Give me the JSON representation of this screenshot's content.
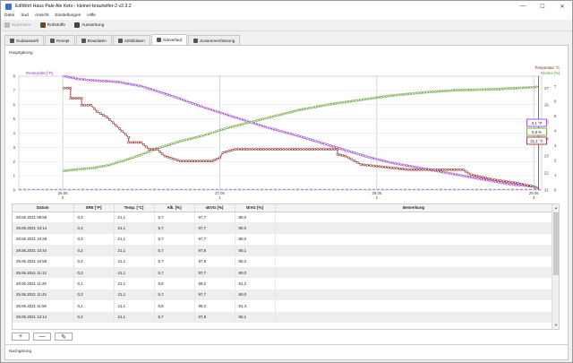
{
  "window": {
    "title": "EdiWort Haus Pale Ale Keto - kleiner-brauhelfer-2 v2.3.2",
    "minimize": "—",
    "maximize": "☐",
    "close": "✕"
  },
  "menu": [
    "Datei",
    "Sud",
    "Ansicht",
    "Einstellungen",
    "Hilfe"
  ],
  "toolbar": {
    "save": "Speichern",
    "ingredients": "Rohstoffe",
    "evaluation": "Auswertung"
  },
  "tabs": [
    "Sudauswahl",
    "Rezept",
    "Braudaten",
    "Abfülldaten",
    "Gärverlauf",
    "Zusammenfassung"
  ],
  "active_tab": "Gärverlauf",
  "groups": {
    "main": "Hauptgärung",
    "post": "Nachgärung"
  },
  "chart_data": {
    "type": "line",
    "left_axis": {
      "label": "Restextrakt [°P]",
      "ticks": [
        "0",
        "1",
        "2",
        "3",
        "4",
        "5",
        "6",
        "7",
        "8"
      ],
      "range": [
        0,
        8
      ]
    },
    "right_axis_1": {
      "label": "Temperatur °C",
      "ticks": [
        "21",
        "22",
        "23",
        "24",
        "25",
        "26",
        "27"
      ],
      "range": [
        21,
        27.7
      ]
    },
    "right_axis_2": {
      "label": "Alkohol [%]",
      "ticks": [
        "0",
        "1",
        "2",
        "3",
        "4",
        "5",
        "6",
        "7"
      ],
      "range": [
        0,
        7.7
      ]
    },
    "x_ticks": [
      {
        "date": "26.06",
        "day": "0"
      },
      {
        "date": "27.06",
        "day": "1"
      },
      {
        "date": "28.06",
        "day": "2"
      },
      {
        "date": "29.06",
        "day": "3"
      }
    ],
    "x_range_days": [
      -0.28,
      3.05
    ],
    "marker_x": 3.03,
    "marker_labels": {
      "extract": "0,1 °P",
      "alcohol": "5,8 %",
      "temperature": "21,1 °C"
    },
    "colors": {
      "extract": "#9b30d0",
      "alcohol": "#5a9a2a",
      "temperature": "#8b1a1a",
      "marker": "#cc2222"
    },
    "series": [
      {
        "key": "extract",
        "points": [
          [
            0.01,
            8.0
          ],
          [
            0.1,
            7.8
          ],
          [
            0.2,
            7.7
          ],
          [
            0.35,
            7.6
          ],
          [
            0.5,
            7.3
          ],
          [
            0.7,
            6.6
          ],
          [
            0.9,
            5.8
          ],
          [
            1.1,
            5.1
          ],
          [
            1.3,
            4.4
          ],
          [
            1.5,
            3.8
          ],
          [
            1.65,
            3.3
          ],
          [
            1.8,
            2.8
          ],
          [
            1.95,
            2.3
          ],
          [
            2.1,
            1.9
          ],
          [
            2.3,
            1.5
          ],
          [
            2.5,
            1.1
          ],
          [
            2.7,
            0.7
          ],
          [
            2.85,
            0.4
          ],
          [
            3.0,
            0.25
          ],
          [
            3.03,
            0.1
          ]
        ]
      },
      {
        "key": "alcohol",
        "points": [
          [
            0.01,
            1.3
          ],
          [
            0.1,
            1.4
          ],
          [
            0.2,
            1.5
          ],
          [
            0.3,
            1.7
          ],
          [
            0.45,
            2.2
          ],
          [
            0.6,
            2.8
          ],
          [
            0.75,
            3.3
          ],
          [
            0.9,
            3.7
          ],
          [
            1.05,
            4.2
          ],
          [
            1.2,
            4.6
          ],
          [
            1.35,
            5.0
          ],
          [
            1.5,
            5.4
          ],
          [
            1.7,
            5.8
          ],
          [
            1.9,
            6.1
          ],
          [
            2.1,
            6.4
          ],
          [
            2.3,
            6.6
          ],
          [
            2.5,
            6.75
          ],
          [
            2.7,
            6.8
          ],
          [
            2.9,
            6.9
          ],
          [
            3.0,
            6.95
          ],
          [
            3.03,
            7.0
          ]
        ]
      },
      {
        "key": "temperature",
        "points": [
          [
            0.01,
            27.0
          ],
          [
            0.05,
            27.0
          ],
          [
            0.05,
            26.4
          ],
          [
            0.12,
            26.4
          ],
          [
            0.12,
            26.0
          ],
          [
            0.18,
            26.0
          ],
          [
            0.22,
            25.6
          ],
          [
            0.28,
            25.3
          ],
          [
            0.34,
            24.8
          ],
          [
            0.42,
            24.1
          ],
          [
            0.42,
            23.8
          ],
          [
            0.5,
            23.8
          ],
          [
            0.55,
            23.4
          ],
          [
            0.6,
            23.4
          ],
          [
            0.65,
            23.0
          ],
          [
            0.75,
            22.7
          ],
          [
            0.95,
            22.7
          ],
          [
            1.0,
            22.9
          ],
          [
            1.02,
            23.2
          ],
          [
            1.1,
            23.4
          ],
          [
            1.75,
            23.4
          ],
          [
            1.75,
            23.1
          ],
          [
            1.8,
            23.0
          ],
          [
            1.9,
            22.5
          ],
          [
            2.0,
            22.4
          ],
          [
            2.2,
            22.2
          ],
          [
            2.55,
            22.2
          ],
          [
            2.6,
            21.9
          ],
          [
            2.75,
            21.6
          ],
          [
            2.9,
            21.4
          ],
          [
            3.0,
            21.2
          ],
          [
            3.03,
            21.1
          ]
        ]
      }
    ]
  },
  "table": {
    "headers": [
      "Datum",
      "SRE [°P]",
      "Temp. [°C]",
      "Alk. [%]",
      "sEVG [%]",
      "tEVG [%]",
      "Bemerkung"
    ],
    "rows": [
      [
        "29.06.2021 09:59",
        "0,3",
        "21,1",
        "5,7",
        "97,7",
        "80,0",
        ""
      ],
      [
        "29.06.2021 10:14",
        "0,3",
        "21,1",
        "5,7",
        "97,7",
        "80,0",
        ""
      ],
      [
        "29.06.2021 10:29",
        "0,3",
        "21,1",
        "5,7",
        "97,7",
        "80,0",
        ""
      ],
      [
        "29.06.2021 10:44",
        "0,2",
        "21,1",
        "5,7",
        "97,8",
        "80,1",
        ""
      ],
      [
        "29.06.2021 10:59",
        "0,2",
        "21,1",
        "5,7",
        "97,9",
        "80,2",
        ""
      ],
      [
        "29.06.2021 11:14",
        "0,3",
        "21,1",
        "5,7",
        "97,7",
        "80,0",
        ""
      ],
      [
        "29.06.2021 11:29",
        "0,1",
        "21,1",
        "5,8",
        "99,2",
        "81,2",
        ""
      ],
      [
        "29.06.2021 11:44",
        "0,3",
        "21,1",
        "5,7",
        "97,7",
        "80,0",
        ""
      ],
      [
        "29.06.2021 11:59",
        "0,1",
        "21,1",
        "5,8",
        "99,2",
        "81,3",
        ""
      ],
      [
        "29.06.2021 12:14",
        "0,2",
        "21,1",
        "5,7",
        "97,8",
        "80,1",
        ""
      ]
    ]
  },
  "buttons": {
    "add": "+",
    "remove": "—",
    "edit": "✎"
  }
}
